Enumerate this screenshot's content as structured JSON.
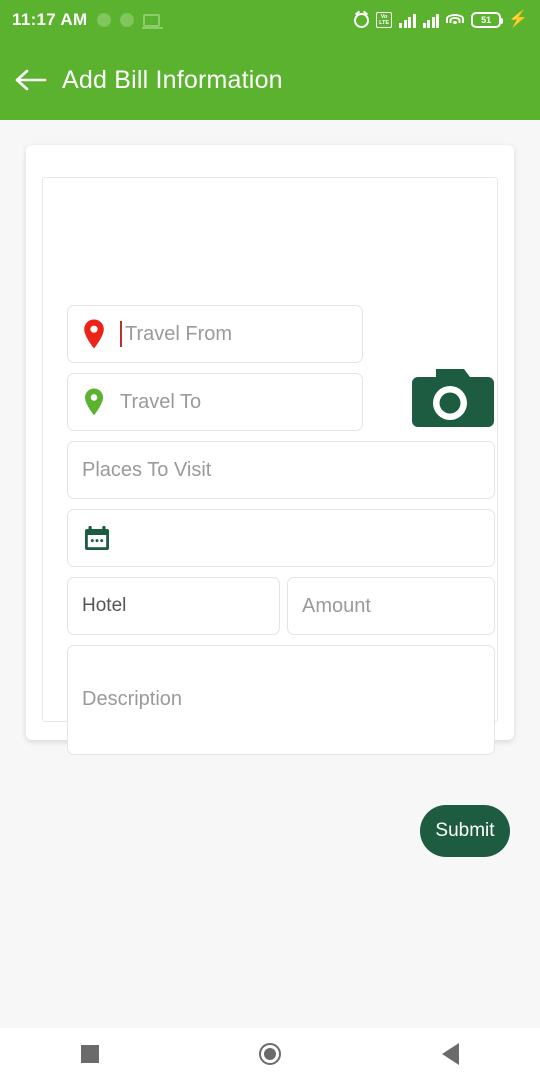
{
  "status_bar": {
    "clock": "11:17 AM",
    "battery_level": "51",
    "icons": [
      "dot-icon",
      "dot-icon",
      "laptop-icon",
      "alarm-icon",
      "volte-icon",
      "signal-icon",
      "signal-icon",
      "wifi-icon",
      "battery-icon",
      "charging-bolt-icon"
    ],
    "volte_top": "Vo",
    "volte_bottom": "LTE",
    "bolt": "⚡"
  },
  "app_bar": {
    "title": "Add Bill Information",
    "back_icon": "arrow-left-icon",
    "background_color": "#5bb22e"
  },
  "form": {
    "travel_from": {
      "placeholder": "Travel From",
      "value": "",
      "icon": "location-pin-red-icon",
      "icon_color": "#ea2419",
      "focused": true
    },
    "travel_to": {
      "placeholder": "Travel To",
      "value": "",
      "icon": "location-pin-green-icon",
      "icon_color": "#5bb22e",
      "focused": false
    },
    "places_to_visit": {
      "placeholder": "Places To Visit",
      "value": ""
    },
    "date": {
      "placeholder": "",
      "value": "",
      "icon": "calendar-icon",
      "icon_color": "#1d5c41"
    },
    "hotel": {
      "placeholder": "Hotel",
      "value": "Hotel"
    },
    "amount": {
      "placeholder": "Amount",
      "value": ""
    },
    "description": {
      "placeholder": "Description",
      "value": ""
    },
    "camera": {
      "icon": "camera-icon",
      "color": "#1d5c41"
    },
    "submit": {
      "label": "Submit",
      "color": "#1d5c41"
    }
  },
  "nav_bar": {
    "recents": "recents-square-icon",
    "home": "home-circle-icon",
    "back": "back-triangle-icon"
  }
}
